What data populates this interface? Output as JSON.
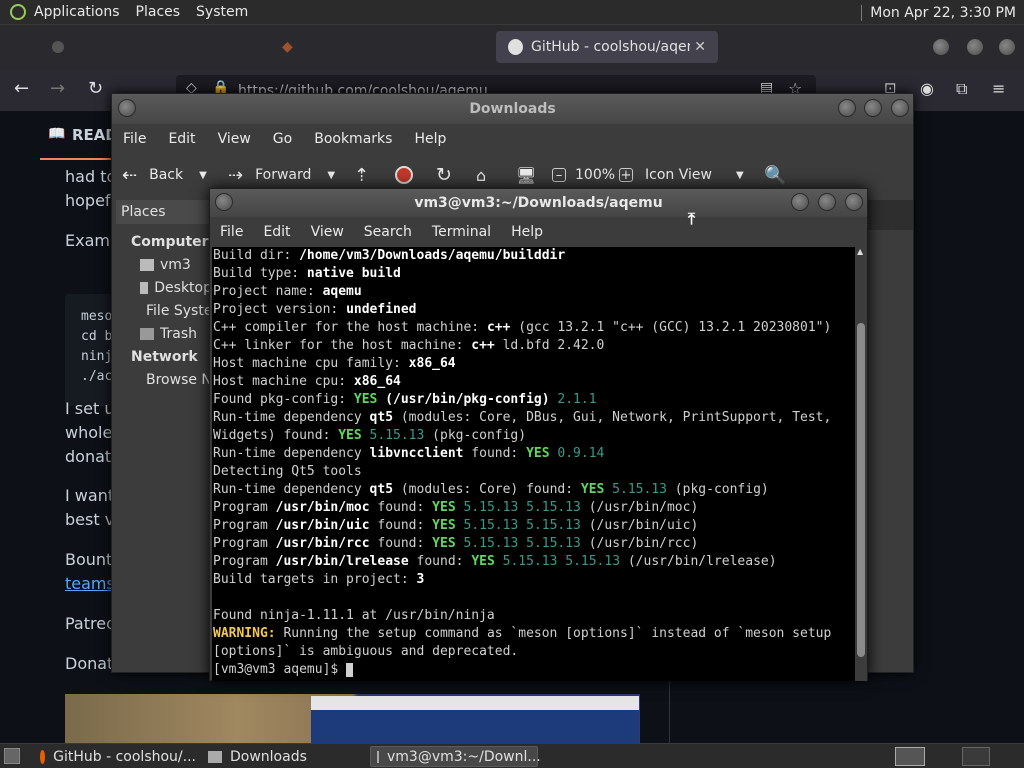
{
  "top_panel": {
    "menus": [
      "Applications",
      "Places",
      "System"
    ],
    "clock": "Mon Apr 22,  3:30 PM"
  },
  "browser": {
    "active_tab": "GitHub - coolshou/aqemu: ",
    "url": "https://github.com/coolshou/aqemu",
    "readme_tab": "READ",
    "page_fragments": [
      "had to",
      "hopeful",
      "Examp",
      "I set up",
      "whole",
      "donatio",
      "I want",
      "best vi",
      "Bounty",
      "teams/",
      "Patreo",
      "Donate"
    ],
    "code_lines": [
      "meso",
      "cd b",
      "ninj",
      "./ac"
    ]
  },
  "files_window": {
    "title": "Downloads",
    "menu": [
      "File",
      "Edit",
      "View",
      "Go",
      "Bookmarks",
      "Help"
    ],
    "toolbar": {
      "back": "Back",
      "forward": "Forward",
      "zoom": "100%",
      "view_mode": "Icon View"
    },
    "places_header": "Places",
    "sidebar": {
      "computer_header": "Computer",
      "computer_items": [
        "vm3",
        "Desktop",
        "File System",
        "Trash"
      ],
      "network_header": "Network",
      "network_items": [
        "Browse Network"
      ]
    }
  },
  "terminal": {
    "title": "vm3@vm3:~/Downloads/aqemu",
    "menu": [
      "File",
      "Edit",
      "View",
      "Search",
      "Terminal",
      "Help"
    ],
    "lines": [
      [
        [
          "n",
          "Build dir: "
        ],
        [
          "b",
          "/home/vm3/Downloads/aqemu/builddir"
        ]
      ],
      [
        [
          "n",
          "Build type: "
        ],
        [
          "b",
          "native build"
        ]
      ],
      [
        [
          "n",
          "Project name: "
        ],
        [
          "b",
          "aqemu"
        ]
      ],
      [
        [
          "n",
          "Project version: "
        ],
        [
          "b",
          "undefined"
        ]
      ],
      [
        [
          "n",
          "C++ compiler for the host machine: "
        ],
        [
          "b",
          "c++"
        ],
        [
          "n",
          " (gcc 13.2.1 \"c++ (GCC) 13.2.1 20230801\")"
        ]
      ],
      [
        [
          "n",
          "C++ linker for the host machine: "
        ],
        [
          "b",
          "c++"
        ],
        [
          "n",
          " ld.bfd 2.42.0"
        ]
      ],
      [
        [
          "n",
          "Host machine cpu family: "
        ],
        [
          "b",
          "x86_64"
        ]
      ],
      [
        [
          "n",
          "Host machine cpu: "
        ],
        [
          "b",
          "x86_64"
        ]
      ],
      [
        [
          "n",
          "Found pkg-config: "
        ],
        [
          "g",
          "YES"
        ],
        [
          "b",
          " (/usr/bin/pkg-config)"
        ],
        [
          "d",
          " 2.1.1"
        ]
      ],
      [
        [
          "n",
          "Run-time dependency "
        ],
        [
          "b",
          "qt5"
        ],
        [
          "n",
          " (modules: Core, DBus, Gui, Network, PrintSupport, Test,"
        ]
      ],
      [
        [
          "n",
          "Widgets) found: "
        ],
        [
          "g",
          "YES"
        ],
        [
          "d",
          " 5.15.13"
        ],
        [
          "n",
          " (pkg-config)"
        ]
      ],
      [
        [
          "n",
          "Run-time dependency "
        ],
        [
          "b",
          "libvncclient"
        ],
        [
          "n",
          " found: "
        ],
        [
          "g",
          "YES"
        ],
        [
          "d",
          " 0.9.14"
        ]
      ],
      [
        [
          "n",
          "Detecting Qt5 tools"
        ]
      ],
      [
        [
          "n",
          "Run-time dependency "
        ],
        [
          "b",
          "qt5"
        ],
        [
          "n",
          " (modules: Core) found: "
        ],
        [
          "g",
          "YES"
        ],
        [
          "d",
          " 5.15.13"
        ],
        [
          "n",
          " (pkg-config)"
        ]
      ],
      [
        [
          "n",
          "Program "
        ],
        [
          "b",
          "/usr/bin/moc"
        ],
        [
          "n",
          " found: "
        ],
        [
          "g",
          "YES"
        ],
        [
          "d",
          " 5.15.13 5.15.13"
        ],
        [
          "n",
          " (/usr/bin/moc)"
        ]
      ],
      [
        [
          "n",
          "Program "
        ],
        [
          "b",
          "/usr/bin/uic"
        ],
        [
          "n",
          " found: "
        ],
        [
          "g",
          "YES"
        ],
        [
          "d",
          " 5.15.13 5.15.13"
        ],
        [
          "n",
          " (/usr/bin/uic)"
        ]
      ],
      [
        [
          "n",
          "Program "
        ],
        [
          "b",
          "/usr/bin/rcc"
        ],
        [
          "n",
          " found: "
        ],
        [
          "g",
          "YES"
        ],
        [
          "d",
          " 5.15.13 5.15.13"
        ],
        [
          "n",
          " (/usr/bin/rcc)"
        ]
      ],
      [
        [
          "n",
          "Program "
        ],
        [
          "b",
          "/usr/bin/lrelease"
        ],
        [
          "n",
          " found: "
        ],
        [
          "g",
          "YES"
        ],
        [
          "d",
          " 5.15.13 5.15.13"
        ],
        [
          "n",
          " (/usr/bin/lrelease)"
        ]
      ],
      [
        [
          "n",
          "Build targets in project: "
        ],
        [
          "b",
          "3"
        ]
      ],
      [
        [
          "n",
          ""
        ]
      ],
      [
        [
          "n",
          "Found ninja-1.11.1 at /usr/bin/ninja"
        ]
      ],
      [
        [
          "y",
          "WARNING:"
        ],
        [
          "n",
          " Running the setup command as `meson [options]` instead of `meson setup"
        ]
      ],
      [
        [
          "n",
          "[options]` is ambiguous and deprecated."
        ]
      ],
      [
        [
          "n",
          "[vm3@vm3 aqemu]$ "
        ]
      ]
    ]
  },
  "taskbar": {
    "items": [
      "GitHub - coolshou/...",
      "Downloads",
      "vm3@vm3:~/Downl..."
    ]
  }
}
